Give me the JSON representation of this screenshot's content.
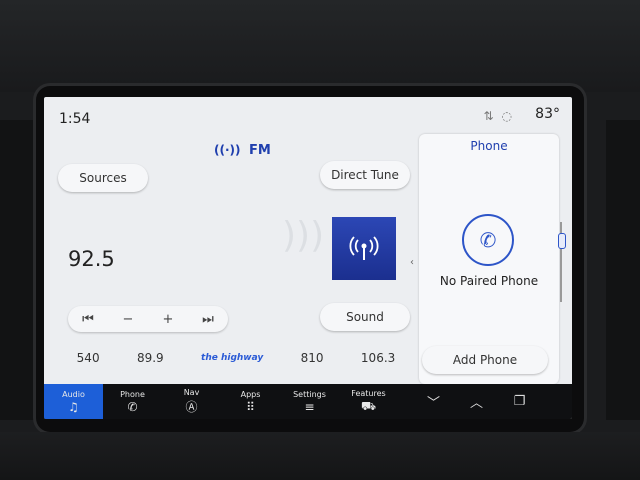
{
  "status": {
    "time": "1:54",
    "temperature": "83°"
  },
  "audio": {
    "band": "FM",
    "sources_label": "Sources",
    "direct_tune_label": "Direct Tune",
    "sound_label": "Sound",
    "frequency": "92.5",
    "controls": [
      "⏮",
      "−",
      "+",
      "⏭"
    ],
    "presets": [
      "540",
      "89.9",
      "the highway",
      "810",
      "106.3"
    ]
  },
  "phone": {
    "title": "Phone",
    "status": "No Paired Phone",
    "add_label": "Add Phone"
  },
  "nav": {
    "items": [
      {
        "label": "Audio",
        "icon": "♫"
      },
      {
        "label": "Phone",
        "icon": "✆"
      },
      {
        "label": "Nav",
        "icon": "Ⓐ"
      },
      {
        "label": "Apps",
        "icon": "⠿"
      },
      {
        "label": "Settings",
        "icon": "≡"
      },
      {
        "label": "Features",
        "icon": "⛟"
      }
    ],
    "utility": [
      "﹀",
      "︿",
      "❐"
    ]
  },
  "colors": {
    "accent": "#1f3fae",
    "active_tab": "#1d5fd8"
  }
}
